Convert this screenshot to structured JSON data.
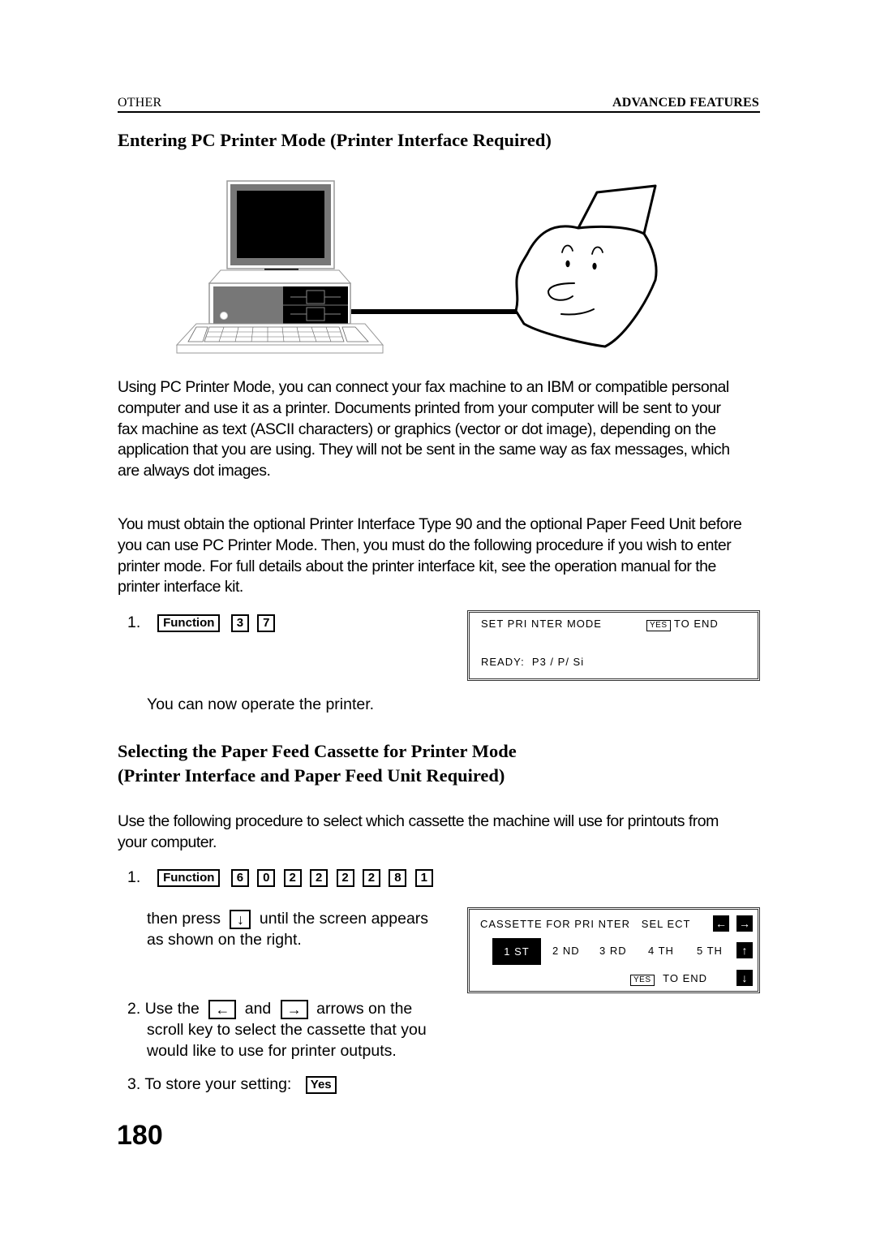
{
  "header": {
    "section_left": "OTHER",
    "section_right": "ADVANCED FEATURES"
  },
  "section1": {
    "title": "Entering PC Printer Mode (Printer Interface Required)",
    "illustration": {
      "left": "personal-computer-icon",
      "right": "fax-machine-face-icon",
      "connector": "cable-icon"
    },
    "paragraph1": "Using PC Printer Mode, you can connect your fax machine to an IBM or compatible personal computer and use it as a printer. Documents printed from your computer will be sent to your fax machine as text (ASCII characters) or graphics (vector or dot image), depending on the application that you are using. They will not be sent in the same way as fax messages, which are always dot images.",
    "paragraph2": "You must obtain the optional Printer Interface Type 90 and the optional Paper Feed Unit before you can use PC Printer Mode. Then, you must do the following procedure if you wish to enter printer mode. For full details about the printer interface kit, see the operation manual for the printer interface kit.",
    "step1": {
      "number": "1.",
      "keys": [
        "Function",
        "3",
        "7"
      ]
    },
    "display": {
      "line1": "SET PRI NTER MODE",
      "yes_key": "YES",
      "to_end": "TO END",
      "line2": "READY:  P3 / P/ Si"
    },
    "result_text": "You can now operate the printer."
  },
  "section2": {
    "title_line1": "Selecting the Paper Feed Cassette for Printer Mode",
    "title_line2": "(Printer Interface and Paper Feed Unit Required)",
    "intro": "Use the following procedure to select which cassette the machine will use for printouts from your computer.",
    "step1": {
      "number": "1.",
      "keys": [
        "Function",
        "6",
        "0",
        "2",
        "2",
        "2",
        "2",
        "8",
        "1"
      ],
      "then_press": "then press",
      "down_key": "↓",
      "then_rest": "until the screen appears",
      "then_line2": "as shown on the right."
    },
    "display": {
      "line1": "CASSETTE FOR PRI NTER   SEL ECT",
      "left_arrow": "←",
      "right_arrow": "→",
      "options": [
        "1 ST",
        "2 ND",
        "3 RD",
        "4 TH",
        "5 TH"
      ],
      "selected_index": 0,
      "up_arrow": "↑",
      "down_arrow": "↓",
      "yes_key": "YES",
      "to_end": "TO END"
    },
    "step2": {
      "number": "2.",
      "text_a": "Use the",
      "left_key": "←",
      "text_b": "and",
      "right_key": "→",
      "text_c": "arrows on the",
      "line2": "scroll key to select the cassette that you",
      "line3": "would like to use for printer outputs."
    },
    "step3": {
      "number": "3.",
      "text": "To store your setting:",
      "key": "Yes"
    }
  },
  "page_number": "180"
}
